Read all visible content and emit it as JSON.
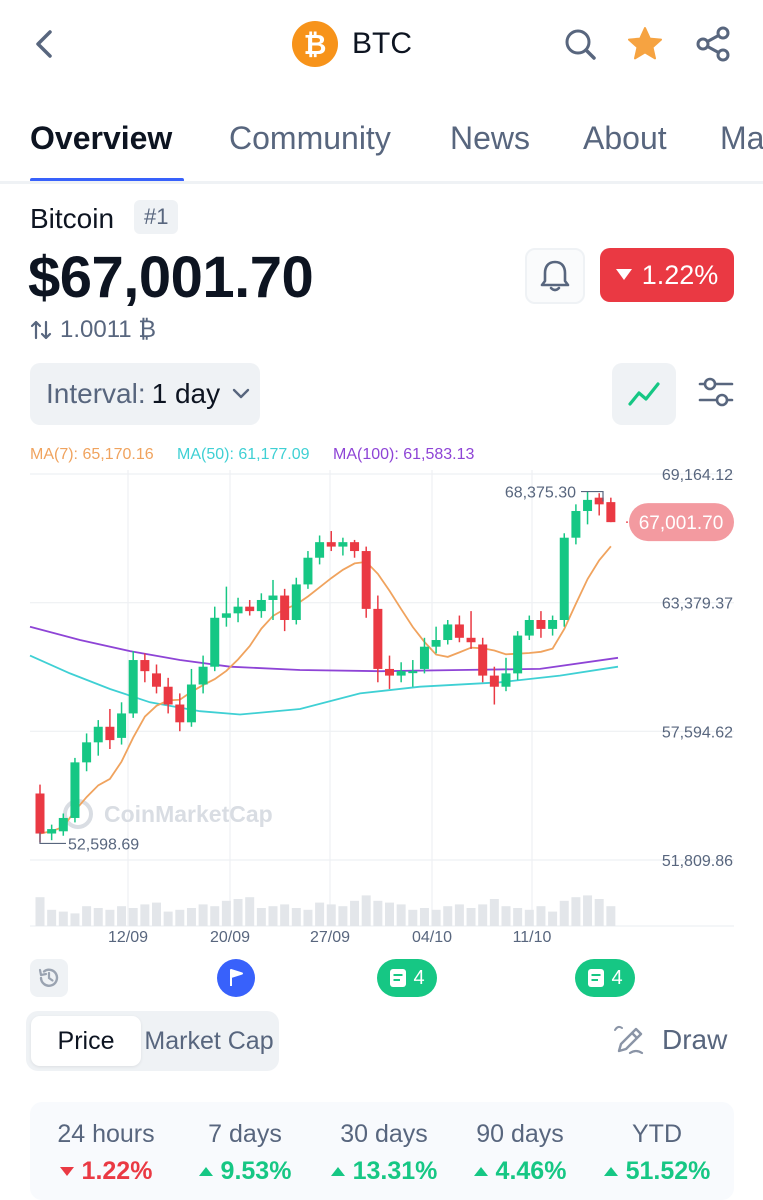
{
  "header": {
    "title": "BTC",
    "coin_symbol_glyph": "₿",
    "icons": [
      "back-arrow-icon",
      "search-icon",
      "star-icon",
      "share-icon"
    ],
    "star_color": "#f6a341"
  },
  "tabs": [
    "Overview",
    "Community",
    "News",
    "About",
    "Ma"
  ],
  "coin": {
    "name": "Bitcoin",
    "rank": "#1",
    "price": "$67,001.70",
    "change": "1.22%",
    "btc_rate": "1.0011 ₿"
  },
  "interval": {
    "label": "Interval:",
    "value": "1 day"
  },
  "chart_data": {
    "type": "candlestick",
    "x_ticks": [
      "12/09",
      "20/09",
      "27/09",
      "04/10",
      "11/10"
    ],
    "y_ticks": [
      69164.12,
      63379.37,
      57594.62,
      51809.86
    ],
    "y_tick_labels": [
      "69,164.12",
      "63,379.37",
      "57,594.62",
      "51,809.86"
    ],
    "ylim": [
      51809.86,
      69164.12
    ],
    "high_label": "68,375.30",
    "low_label": "52,598.69",
    "current_price_label": "67,001.70",
    "watermark": "CoinMarketCap",
    "ma_legend": [
      {
        "label": "MA(7): 65,170.16",
        "color": "#f0a35e"
      },
      {
        "label": "MA(50): 61,177.09",
        "color": "#3fd0d4"
      },
      {
        "label": "MA(100): 61,583.13",
        "color": "#8e44d6"
      }
    ],
    "candles": [
      [
        54800,
        55200,
        52600,
        53000
      ],
      [
        53000,
        53400,
        52700,
        53200
      ],
      [
        53100,
        53900,
        52900,
        53700
      ],
      [
        53700,
        56400,
        53500,
        56200
      ],
      [
        56200,
        57500,
        55800,
        57100
      ],
      [
        57100,
        58100,
        56500,
        57800
      ],
      [
        57800,
        58600,
        56800,
        57200
      ],
      [
        57300,
        58900,
        57000,
        58400
      ],
      [
        58400,
        61200,
        58200,
        60800
      ],
      [
        60800,
        61100,
        59800,
        60300
      ],
      [
        60200,
        60600,
        59300,
        59600
      ],
      [
        59600,
        60000,
        58400,
        58800
      ],
      [
        58800,
        59300,
        57600,
        58000
      ],
      [
        58000,
        60400,
        57800,
        59700
      ],
      [
        59700,
        61000,
        59300,
        60500
      ],
      [
        60500,
        63200,
        60300,
        62700
      ],
      [
        62700,
        64100,
        62300,
        62900
      ],
      [
        62900,
        63600,
        62500,
        63200
      ],
      [
        63200,
        63500,
        62800,
        63000
      ],
      [
        63000,
        63800,
        62700,
        63500
      ],
      [
        63500,
        64400,
        62600,
        63700
      ],
      [
        63700,
        64000,
        62100,
        62600
      ],
      [
        62600,
        64500,
        62400,
        64200
      ],
      [
        64200,
        65700,
        64000,
        65400
      ],
      [
        65400,
        66400,
        65100,
        66100
      ],
      [
        66100,
        66600,
        65700,
        65900
      ],
      [
        65900,
        66300,
        65500,
        66100
      ],
      [
        66100,
        66200,
        65400,
        65700
      ],
      [
        65700,
        65900,
        62700,
        63100
      ],
      [
        63100,
        63700,
        59800,
        60400
      ],
      [
        60400,
        61000,
        59500,
        60100
      ],
      [
        60100,
        60700,
        59800,
        60300
      ],
      [
        60300,
        60800,
        59600,
        60300
      ],
      [
        60400,
        61800,
        60200,
        61400
      ],
      [
        61400,
        62300,
        61100,
        61700
      ],
      [
        61700,
        62600,
        61500,
        62400
      ],
      [
        62400,
        62800,
        61600,
        61800
      ],
      [
        61800,
        63000,
        61300,
        61600
      ],
      [
        61500,
        61800,
        59800,
        60100
      ],
      [
        60100,
        60500,
        58800,
        59600
      ],
      [
        59600,
        60900,
        59400,
        60200
      ],
      [
        60200,
        62100,
        59900,
        61900
      ],
      [
        61900,
        62800,
        61700,
        62600
      ],
      [
        62600,
        63000,
        61800,
        62200
      ],
      [
        62200,
        62800,
        61900,
        62600
      ],
      [
        62600,
        66500,
        62300,
        66300
      ],
      [
        66300,
        67800,
        66000,
        67500
      ],
      [
        67500,
        68375,
        66900,
        68000
      ],
      [
        68100,
        68300,
        67300,
        67800
      ],
      [
        67900,
        68100,
        67000,
        67000
      ]
    ],
    "volume": [
      0.8,
      0.45,
      0.4,
      0.35,
      0.55,
      0.5,
      0.45,
      0.55,
      0.5,
      0.6,
      0.65,
      0.4,
      0.45,
      0.5,
      0.6,
      0.55,
      0.7,
      0.75,
      0.8,
      0.5,
      0.55,
      0.6,
      0.5,
      0.45,
      0.65,
      0.6,
      0.55,
      0.7,
      0.85,
      0.7,
      0.65,
      0.6,
      0.45,
      0.5,
      0.45,
      0.55,
      0.6,
      0.5,
      0.6,
      0.75,
      0.55,
      0.5,
      0.45,
      0.55,
      0.4,
      0.7,
      0.8,
      0.85,
      0.75,
      0.55
    ],
    "volume_color": "#e3e6ea"
  },
  "events": {
    "news_count_1": "4",
    "news_count_2": "4"
  },
  "toggle": {
    "price": "Price",
    "market_cap": "Market Cap",
    "draw": "Draw"
  },
  "performance": [
    {
      "label": "24 hours",
      "value": "1.22%",
      "dir": "down"
    },
    {
      "label": "7 days",
      "value": "9.53%",
      "dir": "up"
    },
    {
      "label": "30 days",
      "value": "13.31%",
      "dir": "up"
    },
    {
      "label": "90 days",
      "value": "4.46%",
      "dir": "up"
    },
    {
      "label": "YTD",
      "value": "51.52%",
      "dir": "up"
    }
  ],
  "colors": {
    "up": "#16c784",
    "down": "#ea3943",
    "accent": "#3861fb"
  }
}
